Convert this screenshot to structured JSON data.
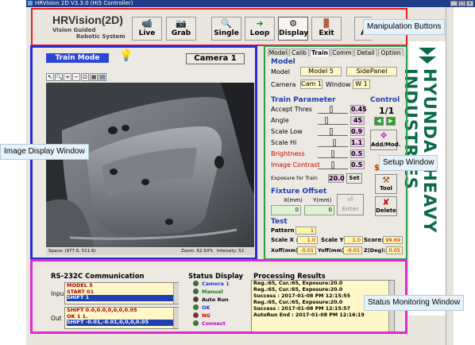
{
  "window": {
    "title": "HRVision 2D V3.3.0 (Hi5 Controller)"
  },
  "logo": {
    "title": "HRVision(2D)",
    "subtitle_line1": "Vision Guided",
    "subtitle_line2": "Robotic System"
  },
  "toolbar": {
    "live": "Live",
    "grab": "Grab",
    "single": "Single",
    "loop": "Loop",
    "display": "Display",
    "exit": "Exit",
    "auto": "A"
  },
  "annotations": {
    "manipulation": "Manipulation Buttons",
    "image_display": "Image Display Window",
    "setup": "Setup Window",
    "status": "Status Monitoring Window"
  },
  "image_panel": {
    "mode": "Train Mode",
    "camera": "Camera 1",
    "status_space": "Space: (977.6, 511.6)",
    "status_zoom": "Zoom: 62.50%",
    "status_intensity": "Intensity: 52"
  },
  "setup": {
    "tabs": [
      "Model",
      "Calib",
      "Train",
      "Comm",
      "Detail",
      "Option"
    ],
    "model_section": "Model",
    "model_label": "Model",
    "model_value": "Model 5",
    "model_side": "SidePanel",
    "camera_label": "Camera",
    "camera_value": "Cam 1",
    "window_label": "Window",
    "window_value": "W 1",
    "train_param": "Train Parameter",
    "params": [
      {
        "label": "Accept Thres",
        "value": "0.45",
        "level": 0.45,
        "color": "#000000"
      },
      {
        "label": "Angle",
        "value": "45",
        "level": 0.25,
        "color": "#000000"
      },
      {
        "label": "Scale Low",
        "value": "0.9",
        "level": 0.45,
        "color": "#000000"
      },
      {
        "label": "Scale Hi",
        "value": "1.1",
        "level": 0.55,
        "color": "#000000"
      },
      {
        "label": "Brightness",
        "value": "0.5",
        "level": 0.5,
        "color": "#d00000"
      },
      {
        "label": "Image Contrast",
        "value": "0.5",
        "level": 0.5,
        "color": "#d00000"
      }
    ],
    "exposure_label": "Exposure for Train",
    "exposure_value": "20.0",
    "set_button": "Set",
    "control_title": "Control",
    "control_page": "1/1",
    "add_mod": "Add/Mod.",
    "tool": "Tool",
    "delete": "Delete",
    "fixture_title": "Fixture Offset",
    "x_label": "X(mm)",
    "y_label": "Y(mm)",
    "x_value": "0",
    "y_value": "0",
    "enter": "Enter",
    "test_title": "Test",
    "pattern_label": "Pattern :",
    "pattern_value": "1",
    "scale_x_label": "Scale X :",
    "scale_x_value": "1.0",
    "scale_y_label": "Scale Y :",
    "scale_y_value": "1.0",
    "score_label": "Score:",
    "score_value": "99.69",
    "xoff_label": "Xoff(mm):",
    "xoff_value": "-0.01",
    "yoff_label": "Yoff(mm):",
    "yoff_value": "-0.01",
    "zdeg_label": "Z(Deg):",
    "zdeg_value": "0.05"
  },
  "banner": {
    "text": "HYUNDAI HEAVY INDUSTRIES"
  },
  "rs232": {
    "title": "RS-232C Communication",
    "input_label": "Input",
    "input_lines": [
      "MODEL 5",
      "START 01",
      "SHIFT 1"
    ],
    "out_label": "Out",
    "out_lines": [
      "SHIFT 0.0,0.0,0,0,0,0.05",
      "OK 1 1.",
      "SHIFT -0.01,-0.01,0,0,0,0.05"
    ]
  },
  "status_display": {
    "title": "Status Display",
    "items": [
      {
        "label": "Camera 1",
        "color": "#1a3fd0",
        "led": "#2a7a2a"
      },
      {
        "label": "Manual",
        "color": "#1a7a1a",
        "led": "#2a7a2a"
      },
      {
        "label": "Auto Run",
        "color": "#000000",
        "led": "#5a3a10"
      },
      {
        "label": "OK",
        "color": "#1a3fd0",
        "led": "#2a8a2a"
      },
      {
        "label": "NG",
        "color": "#d00000",
        "led": "#8a2a2a"
      },
      {
        "label": "Connect",
        "color": "#c000c0",
        "led": "#2a8a2a"
      }
    ]
  },
  "processing": {
    "title": "Processing Results",
    "lines": [
      "Reg.:65, Cur.:65, Exposure:20.0",
      "Reg.:65, Cur.:65, Exposure:20.0",
      "Success : 2017-01-08 PM 12:15:55",
      "Reg.:65, Cur.:65, Exposure:20.0",
      "Success : 2017-01-08 PM 12:15:57",
      "AutoRun End : 2017-01-08 PM 12:16:19"
    ]
  }
}
